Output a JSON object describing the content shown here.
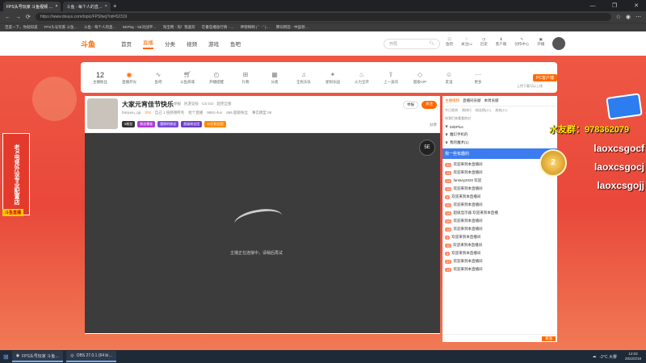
{
  "browser": {
    "tabs": [
      "FPS头号玩家 斗鱼视频 …",
      "斗鱼 - 每个人的直…"
    ],
    "url": "https://www.douyu.com/topic/FPSfwq?rid=52319",
    "bookmarks": [
      "百度一下，你就知道",
      "FPS头号玩家 斗鱼…",
      "斗鱼 - 每个人的直…",
      "5EPlay - 5E对战平…",
      "淘宝网 - 淘！我喜欢",
      "在番茄播放行情 - …",
      "神嗯啊啊 ( ˘ · ˘ )…",
      "腾讯网首 - 中国领…"
    ]
  },
  "site": {
    "logo": "斗鱼",
    "nav": [
      "首页",
      "直播",
      "分类",
      "视频",
      "游戏",
      "鱼吧"
    ],
    "search_placeholder": "开局",
    "top_icons": [
      "鱼吧",
      "关注Lv",
      "历史",
      "客户端",
      "创作中心",
      "开播"
    ]
  },
  "categories": {
    "count": "12",
    "items": [
      "主播粉丝",
      "直播开光",
      "鱼吧",
      "斗鱼商城",
      "开播提醒",
      "礼物",
      "分类",
      "全民乐队",
      "星粉乐园",
      "火力全开",
      "上一波问",
      "超级VIP",
      "友谊",
      "更多"
    ],
    "pc_label": "PC客户端",
    "pc_sub": "上传下载可以上线"
  },
  "room": {
    "title": "大家元宵佳节快乐",
    "tags": [
      "举报",
      "民游竞技",
      "CS:GO",
      "超完全部"
    ],
    "owner": "famjusu_qq",
    "stats": [
      "374",
      "自己 1 倍感谢所有",
      "给个直播",
      "9981+fun",
      "666 超级粉丝",
      "事实模型 59"
    ],
    "badges": [
      "5粉丝",
      "粉丝模板",
      "跟踪的粉丝",
      "超级粉丝团",
      "10大粉丝团"
    ],
    "share": "分享",
    "report": "举报",
    "follow": "关注",
    "loading": "主播正在连接中，请稍后再试"
  },
  "sidebar": {
    "tabs": [
      "主播视频",
      "直播间贡献",
      "本周贡献"
    ],
    "subtabs": [
      "今日贵宾",
      "周排行",
      "粉丝榜(17)",
      "贵宾(17)"
    ],
    "rank_title": "给我们来看看他对",
    "rank_items": [
      {
        "name": "MiDPlus"
      },
      {
        "name": "魔幻手机的"
      },
      {
        "name": "我的魔术(1)"
      }
    ],
    "banner": "我一些有趣的",
    "chat": [
      {
        "lv": "32",
        "text": "欢迎来到本直播间"
      },
      {
        "lv": "14",
        "text": "欢迎来到本直播间"
      },
      {
        "lv": "12",
        "text": "fantasy2020 欢迎"
      },
      {
        "lv": "19",
        "text": "欢迎来到本直播间"
      },
      {
        "lv": "8",
        "text": "欢迎来到本直播间"
      },
      {
        "lv": "20",
        "text": "欢迎来到本直播间"
      },
      {
        "lv": "15",
        "text": "超级显示器 欢迎来到本直播"
      },
      {
        "lv": "29",
        "text": "欢迎来到本直播间"
      },
      {
        "lv": "13",
        "text": "欢迎来到本直播间"
      },
      {
        "lv": "4",
        "text": "欢迎来到本直播间"
      },
      {
        "lv": "11",
        "text": "欢迎来到本直播间"
      },
      {
        "lv": "6",
        "text": "欢迎来到本直播间"
      },
      {
        "lv": "27",
        "text": "欢迎来到本直播间"
      },
      {
        "lv": "17",
        "text": "欢迎来到本直播间"
      }
    ],
    "send": "发送"
  },
  "overlay": {
    "qq": "水友群：978362079",
    "lines": [
      "laoxcsgocf",
      "laoxcsgocj",
      "laoxcsgojj"
    ],
    "left_banner": "老X电竞外设专业配置店",
    "left_small": "斗鱼直播"
  },
  "taskbar": {
    "apps": [
      "FPS头号玩家 斗鱼…",
      "OBS 27.0.1 (64 bi…"
    ],
    "weather": "-2°C 大雾",
    "time": "12:03",
    "date": "2022/2/19"
  }
}
